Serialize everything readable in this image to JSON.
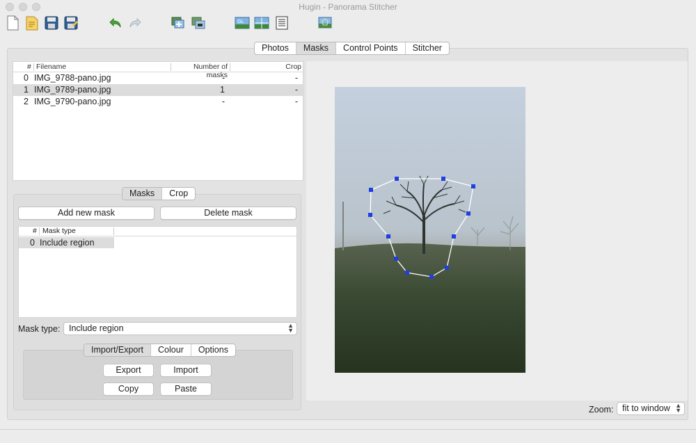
{
  "window": {
    "title": "Hugin - Panorama Stitcher"
  },
  "toolbar": {
    "buttons": [
      "new-project",
      "open-project",
      "save-project",
      "save-as",
      "undo",
      "redo",
      "add-images",
      "assistant-align",
      "fast-preview",
      "preview-panorama",
      "control-point-table",
      "show-mask"
    ]
  },
  "main_tabs": [
    {
      "label": "Photos",
      "active": false
    },
    {
      "label": "Masks",
      "active": true
    },
    {
      "label": "Control Points",
      "active": false
    },
    {
      "label": "Stitcher",
      "active": false
    }
  ],
  "file_table": {
    "headers": {
      "num": "#",
      "filename": "Filename",
      "masks": "Number of masks",
      "crop": "Crop"
    },
    "rows": [
      {
        "num": "0",
        "filename": "IMG_9788-pano.jpg",
        "masks": "-",
        "crop": "-"
      },
      {
        "num": "1",
        "filename": "IMG_9789-pano.jpg",
        "masks": "1",
        "crop": "-"
      },
      {
        "num": "2",
        "filename": "IMG_9790-pano.jpg",
        "masks": "-",
        "crop": "-"
      }
    ],
    "selected_index": 1
  },
  "sub_tabs": [
    {
      "label": "Masks",
      "active": true
    },
    {
      "label": "Crop",
      "active": false
    }
  ],
  "mask_buttons": {
    "add": "Add new mask",
    "delete": "Delete mask"
  },
  "mask_table": {
    "headers": {
      "num": "#",
      "type": "Mask type"
    },
    "rows": [
      {
        "num": "0",
        "type": "Include region"
      }
    ]
  },
  "mask_type": {
    "label": "Mask type:",
    "value": "Include region"
  },
  "import_tabs": [
    {
      "label": "Import/Export",
      "active": true
    },
    {
      "label": "Colour",
      "active": false
    },
    {
      "label": "Options",
      "active": false
    }
  ],
  "import_buttons": {
    "export": "Export",
    "import": "Import",
    "copy": "Copy",
    "paste": "Paste"
  },
  "zoom": {
    "label": "Zoom:",
    "value": "fit to window"
  },
  "colors": {
    "mask_point": "#1f3fe0",
    "mask_line": "#ffffff"
  }
}
